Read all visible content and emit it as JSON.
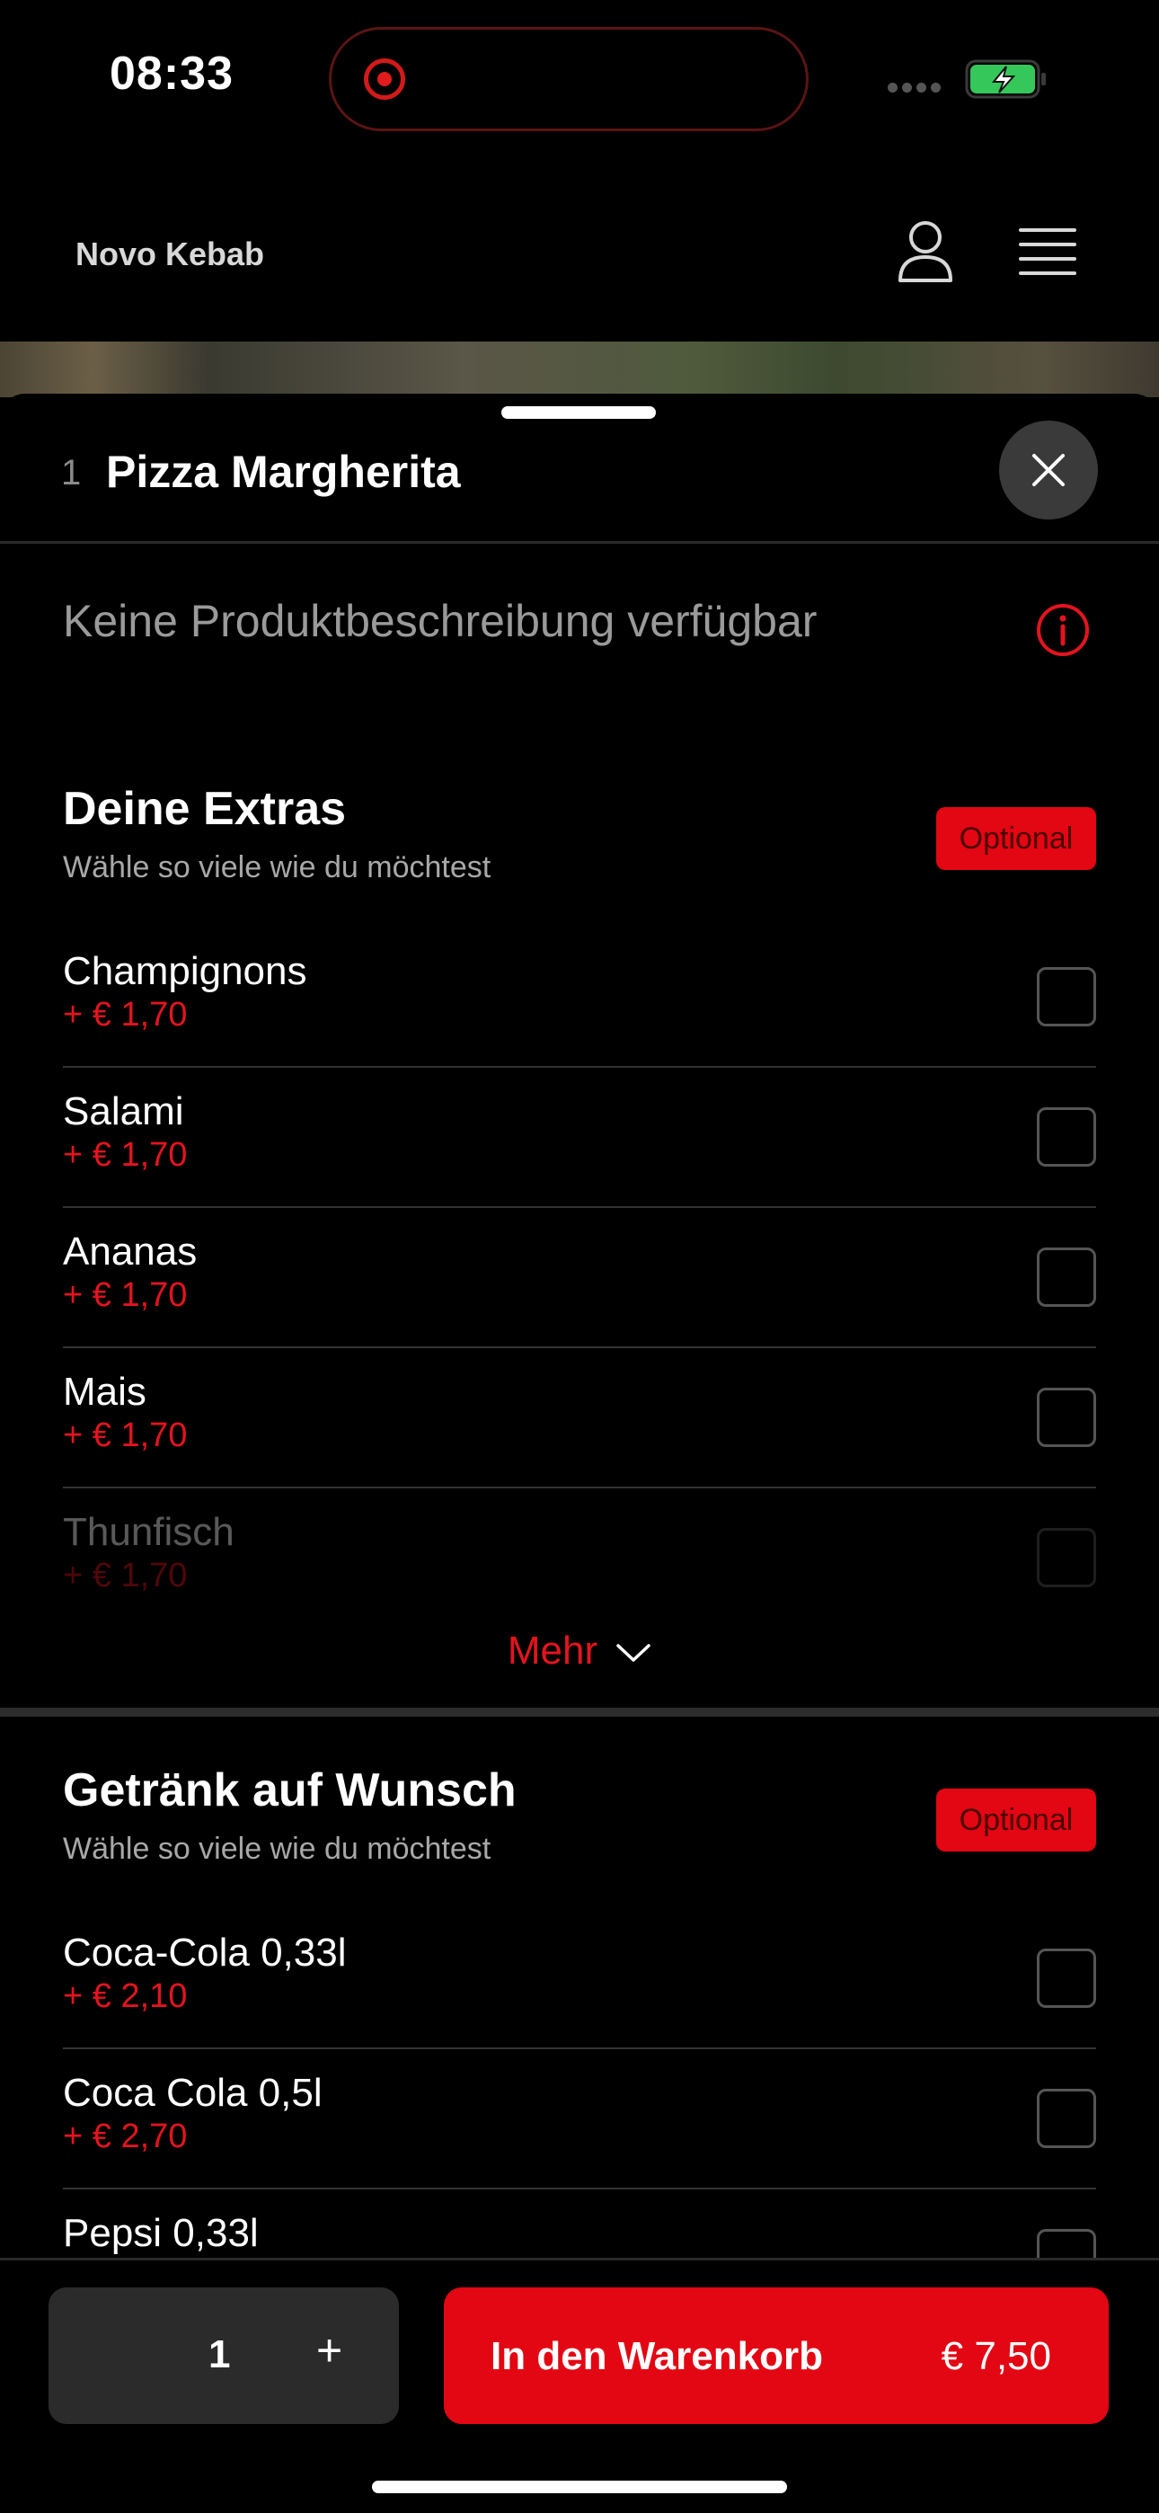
{
  "status_bar": {
    "time": "08:33"
  },
  "header": {
    "brand": "Novo Kebab"
  },
  "product": {
    "number": "1",
    "title": "Pizza Margherita",
    "description": "Keine Produktbeschreibung verfügbar"
  },
  "sections": [
    {
      "title": "Deine Extras",
      "subtitle": "Wähle so viele wie du möchtest",
      "badge": "Optional",
      "items": [
        {
          "name": "Champignons",
          "price": "+ € 1,70",
          "checked": false
        },
        {
          "name": "Salami",
          "price": "+ € 1,70",
          "checked": false
        },
        {
          "name": "Ananas",
          "price": "+ € 1,70",
          "checked": false
        },
        {
          "name": "Mais",
          "price": "+ € 1,70",
          "checked": false
        },
        {
          "name": "Thunfisch",
          "price": "+ € 1,70",
          "checked": false
        }
      ],
      "more_label": "Mehr"
    },
    {
      "title": "Getränk auf Wunsch",
      "subtitle": "Wähle so viele wie du möchtest",
      "badge": "Optional",
      "items": [
        {
          "name": "Coca-Cola 0,33l",
          "price": "+ € 2,10",
          "checked": false
        },
        {
          "name": "Coca Cola 0,5l",
          "price": "+ € 2,70",
          "checked": false
        },
        {
          "name": "Pepsi 0,33l",
          "checked": false
        }
      ]
    }
  ],
  "footer": {
    "quantity": "1",
    "plus_label": "+",
    "add_to_cart_label": "In den Warenkorb",
    "total_price": "€ 7,50"
  },
  "colors": {
    "accent": "#e30613",
    "price": "#e3141e",
    "background": "#000000",
    "battery": "#35c759"
  },
  "icons": [
    "user-icon",
    "menu-icon",
    "close-icon",
    "info-icon",
    "chevron-down-icon",
    "battery-charging-icon"
  ]
}
